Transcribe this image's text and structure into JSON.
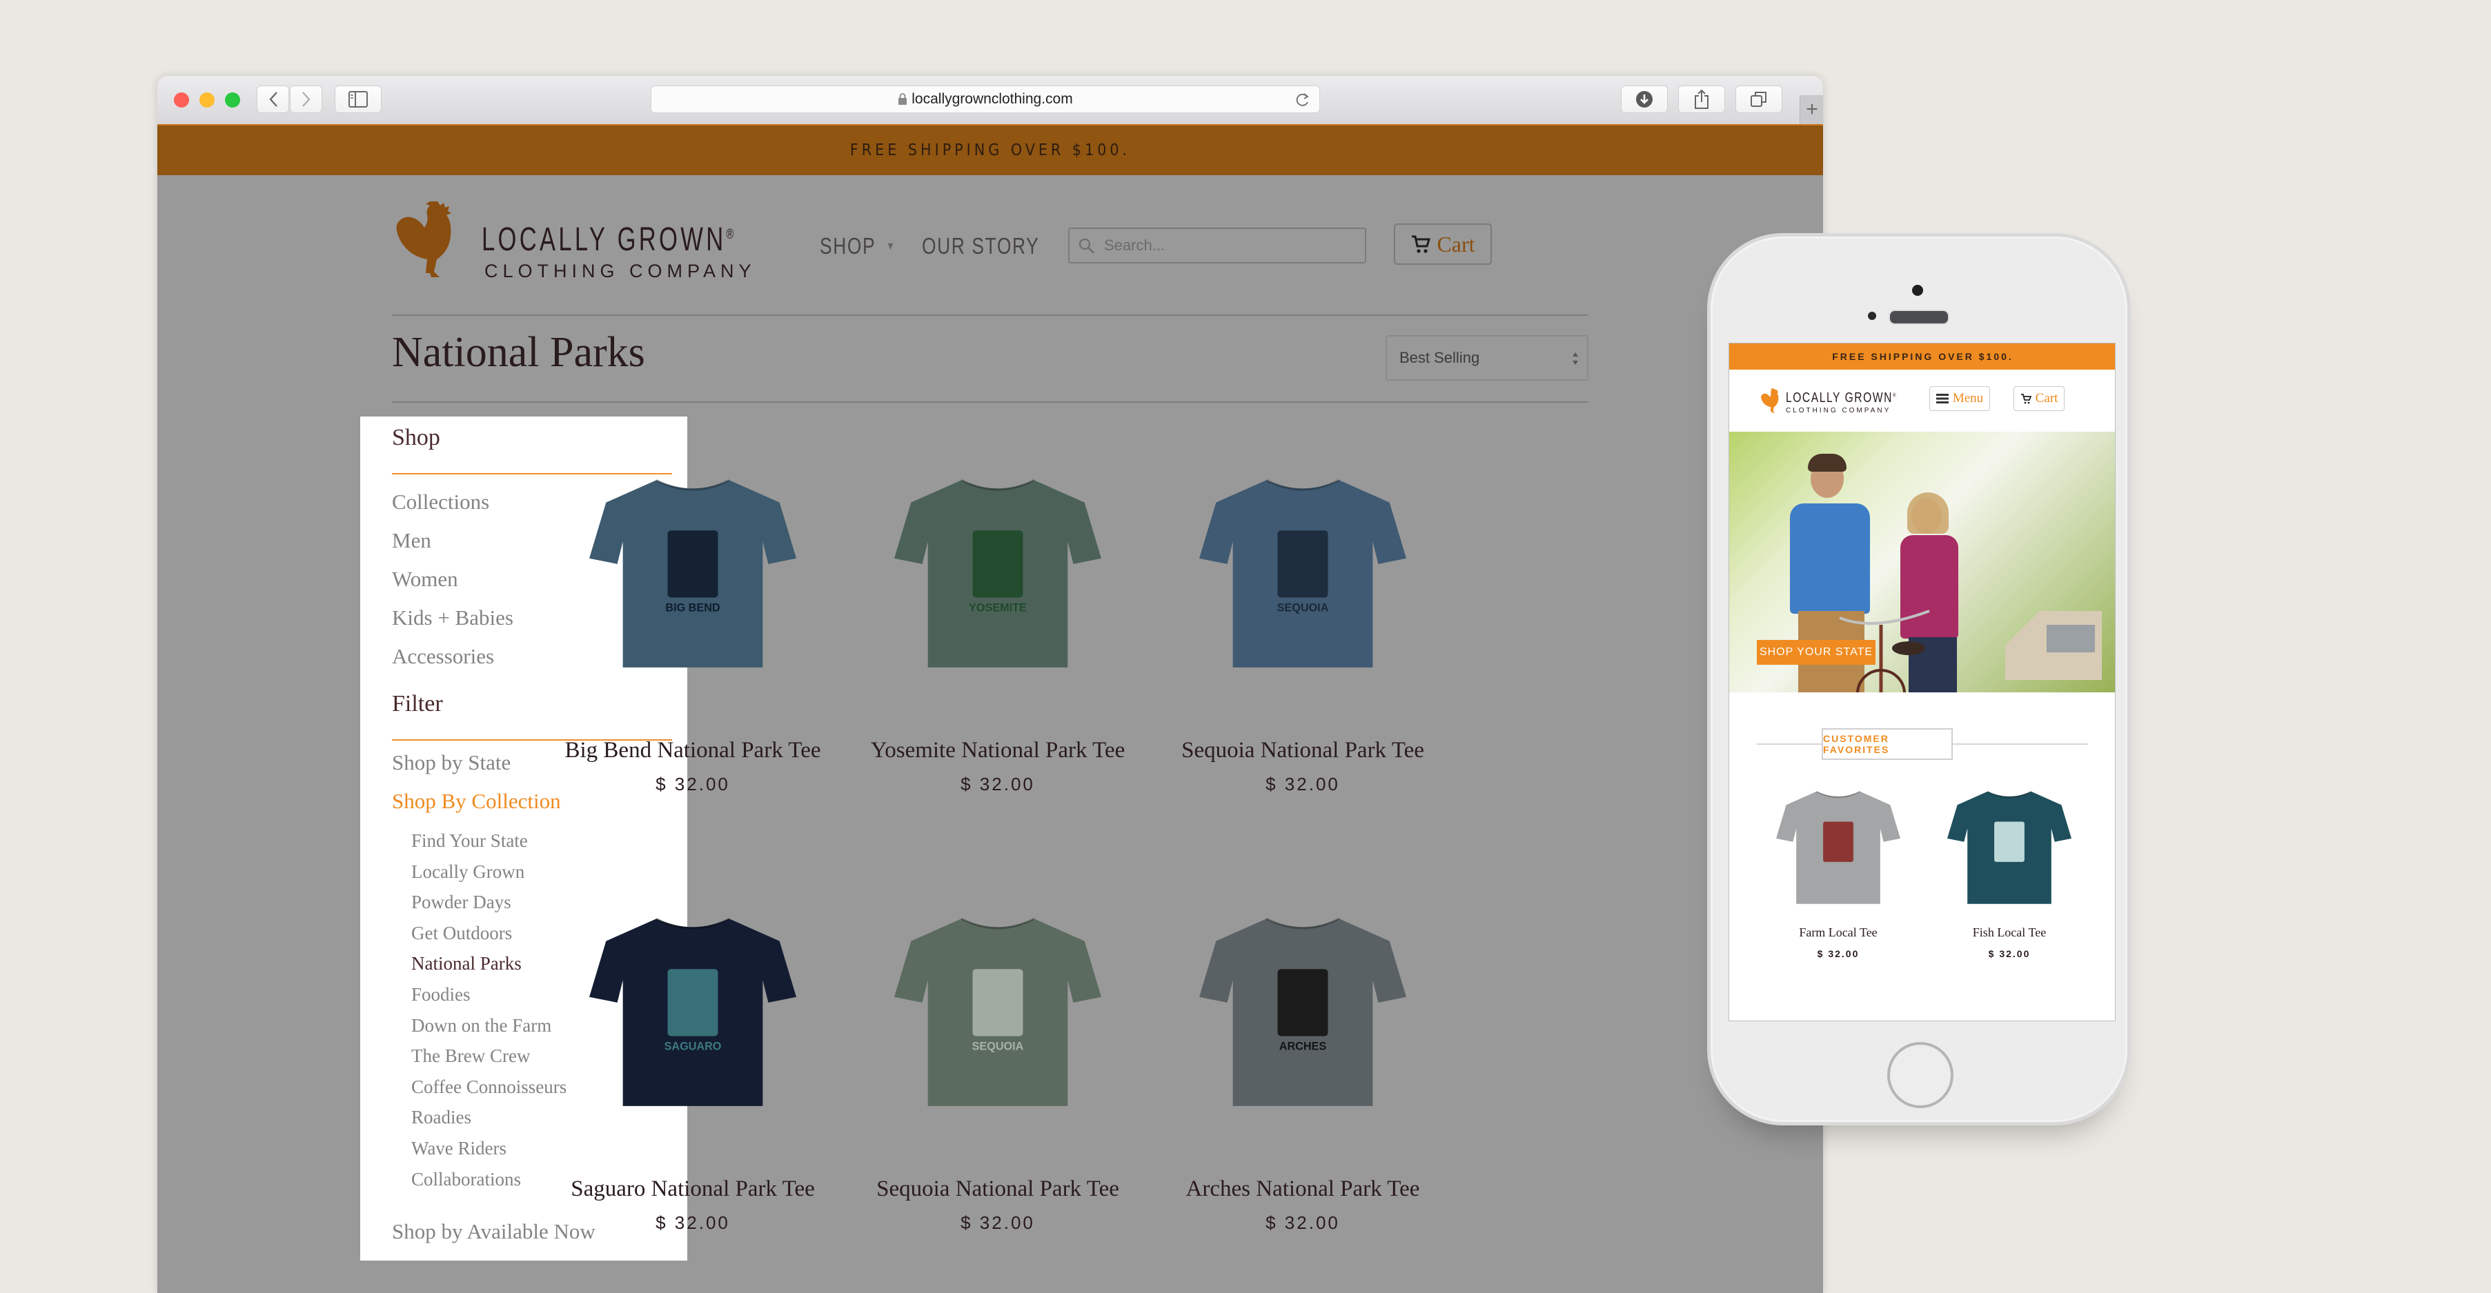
{
  "browser": {
    "url": "locallygrownclothing.com",
    "icons": {
      "back": "chevron-left-icon",
      "forward": "chevron-right-icon",
      "sidebar": "sidebar-icon",
      "lock": "lock-icon",
      "reload": "reload-icon",
      "downloads": "download-icon",
      "share": "share-icon",
      "tabs": "tabs-icon",
      "new_tab": "+"
    },
    "traffic_lights": {
      "close": "#fe5f57",
      "minimize": "#febc2e",
      "zoom": "#28c840"
    }
  },
  "site": {
    "shipping_banner": "FREE SHIPPING OVER $100.",
    "logo": {
      "line1": "LOCALLY GROWN",
      "registered": "®",
      "line2": "CLOTHING COMPANY"
    },
    "nav": {
      "shop": "SHOP",
      "our_story": "OUR STORY"
    },
    "search": {
      "placeholder": "Search..."
    },
    "cart_label": "Cart",
    "colors": {
      "brand_orange": "#ef8b20",
      "text_dark": "#2a1b1d",
      "overlay_gray": "#999999"
    }
  },
  "collection": {
    "title": "National Parks",
    "sort": {
      "selected": "Best Selling"
    }
  },
  "sidebar": {
    "shop_heading": "Shop",
    "shop_items": [
      "Collections",
      "Men",
      "Women",
      "Kids + Babies",
      "Accessories"
    ],
    "filter_heading": "Filter",
    "filter_items": {
      "shop_by_state": "Shop by State",
      "shop_by_collection": "Shop By Collection",
      "collections": [
        "Find Your State",
        "Locally Grown",
        "Powder Days",
        "Get Outdoors",
        "National Parks",
        "Foodies",
        "Down on the Farm",
        "The Brew Crew",
        "Coffee Connoisseurs",
        "Roadies",
        "Wave Riders",
        "Collaborations"
      ],
      "active_collection": "National Parks",
      "shop_by_available_now": "Shop by Available Now"
    }
  },
  "products": [
    {
      "name": "Big Bend National Park Tee",
      "price": "$ 32.00",
      "shirt_color": "#3d5a6e",
      "print": "BIG BEND",
      "print_color": "#0f1c2e"
    },
    {
      "name": "Yosemite National Park Tee",
      "price": "$ 32.00",
      "shirt_color": "#4c6258",
      "print": "YOSEMITE",
      "print_color": "#1f4a2b"
    },
    {
      "name": "Sequoia National Park Tee",
      "price": "$ 32.00",
      "shirt_color": "#3f5a72",
      "print": "SEQUOIA",
      "print_color": "#1a2838"
    },
    {
      "name": "Saguaro National Park Tee",
      "price": "$ 32.00",
      "shirt_color": "#141c32",
      "print": "SAGUARO",
      "print_color": "#3c7a80"
    },
    {
      "name": "Sequoia National Park Tee",
      "price": "$ 32.00",
      "shirt_color": "#5c6b60",
      "print": "SEQUOIA",
      "print_color": "#a9b2aa"
    },
    {
      "name": "Arches National Park Tee",
      "price": "$ 32.00",
      "shirt_color": "#5a6165",
      "print": "ARCHES",
      "print_color": "#141414"
    }
  ],
  "mobile": {
    "shipping_banner": "FREE SHIPPING OVER $100.",
    "menu_label": "Menu",
    "cart_label": "Cart",
    "hero_cta": "SHOP YOUR STATE",
    "favorites_heading": "CUSTOMER FAVORITES",
    "products": [
      {
        "name": "Farm Local Tee",
        "price": "$ 32.00",
        "shirt_color": "#a3a5a6",
        "print_color": "#8a2a28"
      },
      {
        "name": "Fish Local Tee",
        "price": "$ 32.00",
        "shirt_color": "#1f4f5c",
        "print_color": "#cde8e6"
      }
    ]
  }
}
